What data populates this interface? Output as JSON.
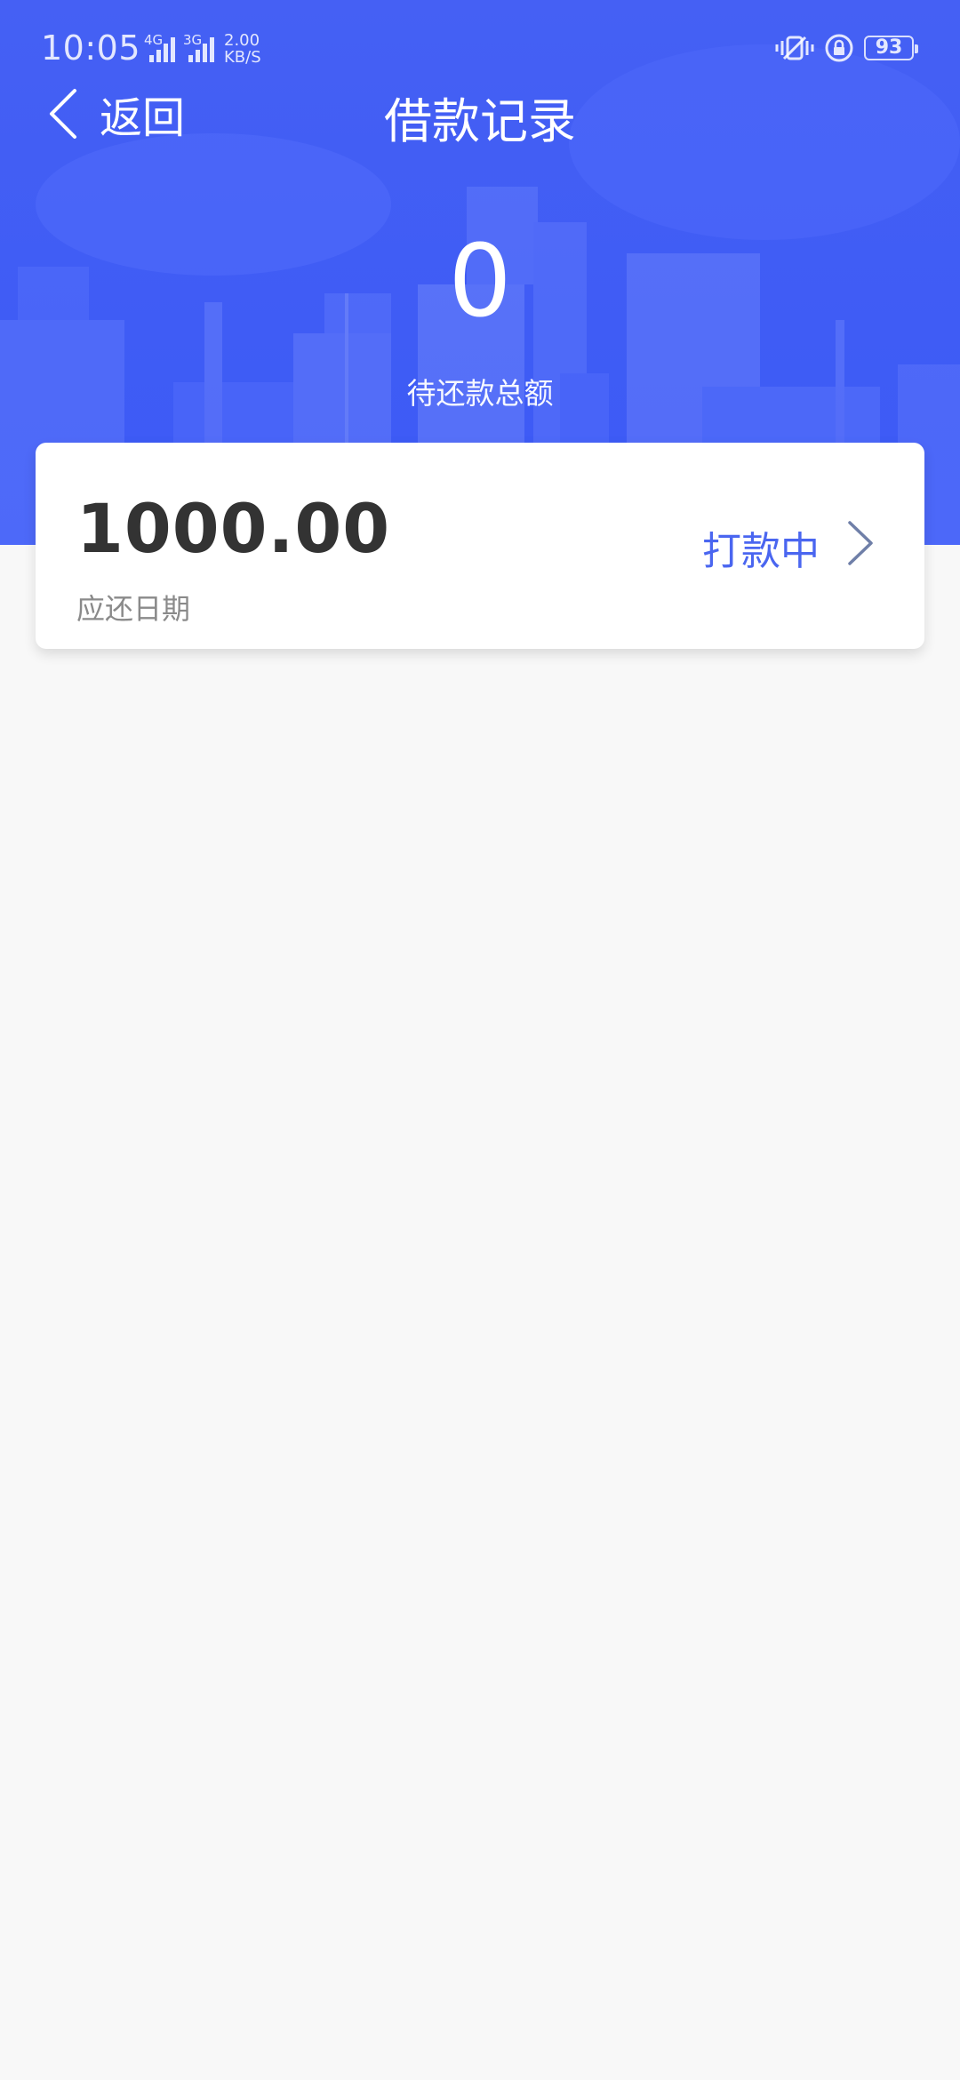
{
  "status_bar": {
    "time": "10:05",
    "network_1": "4G",
    "network_2": "3G",
    "speed_value": "2.00",
    "speed_unit": "KB/S",
    "battery": "93"
  },
  "nav": {
    "back_label": "返回",
    "title": "借款记录"
  },
  "summary": {
    "amount": "0",
    "label": "待还款总额"
  },
  "loans": [
    {
      "amount": "1000.00",
      "due_label": "应还日期",
      "status": "打款中"
    }
  ],
  "colors": {
    "header_blue": "#4560f4",
    "status_text": "#4a66f0",
    "amount_text": "#333333",
    "muted_text": "#8a8a8a",
    "page_bg": "#f8f8f8"
  },
  "icons": {
    "back": "chevron-left-icon",
    "detail": "chevron-right-icon",
    "vibrate": "vibrate-icon",
    "rotation_lock": "rotation-lock-icon",
    "signal": "signal-icon"
  }
}
